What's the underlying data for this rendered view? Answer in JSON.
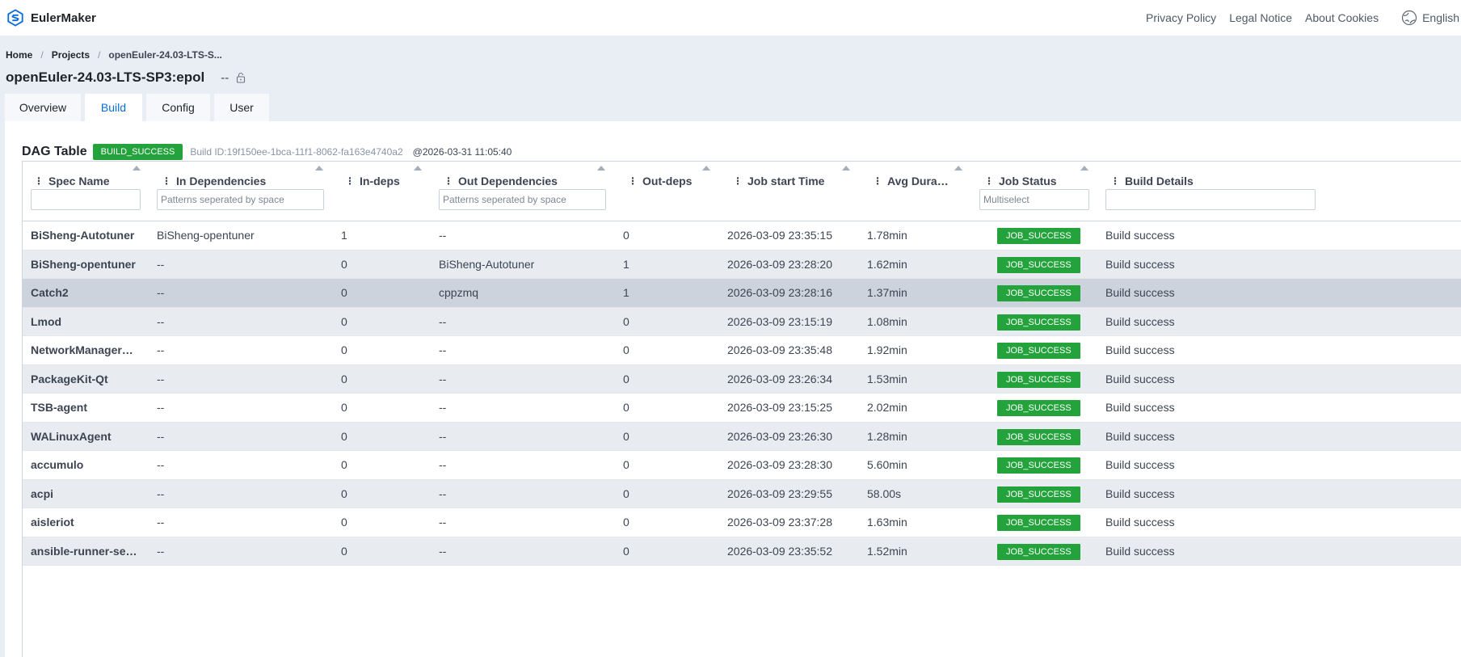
{
  "topbar": {
    "app_name": "EulerMaker",
    "links": [
      "Privacy Policy",
      "Legal Notice",
      "About Cookies"
    ],
    "language": "English"
  },
  "breadcrumb": [
    "Home",
    "Projects",
    "openEuler-24.03-LTS-S..."
  ],
  "page": {
    "title": "openEuler-24.03-LTS-SP3:epol",
    "dash": "--"
  },
  "tabs": [
    "Overview",
    "Build",
    "Config",
    "User"
  ],
  "active_tab": "Build",
  "dag": {
    "title": "DAG Table",
    "status": "BUILD_SUCCESS",
    "build_id": "Build ID:19f150ee-1bca-11f1-8062-fa163e4740a2",
    "time": "@2026-03-31 11:05:40"
  },
  "columns": [
    "Spec Name",
    "In Dependencies",
    "In-deps",
    "Out Dependencies",
    "Out-deps",
    "Job start Time",
    "Avg Dura…",
    "Job Status",
    "Build Details"
  ],
  "filters": {
    "in_deps_placeholder": "Patterns seperated by space",
    "out_deps_placeholder": "Patterns seperated by space",
    "status_placeholder": "Multiselect"
  },
  "rows": [
    {
      "name": "BiSheng-Autotuner",
      "in_deps": "BiSheng-opentuner",
      "in_count": "1",
      "out_deps": "--",
      "out_count": "0",
      "start": "2026-03-09 23:35:15",
      "avg": "1.78min",
      "status": "JOB_SUCCESS",
      "details": "Build success"
    },
    {
      "name": "BiSheng-opentuner",
      "in_deps": "--",
      "in_count": "0",
      "out_deps": "BiSheng-Autotuner",
      "out_count": "1",
      "start": "2026-03-09 23:28:20",
      "avg": "1.62min",
      "status": "JOB_SUCCESS",
      "details": "Build success"
    },
    {
      "name": "Catch2",
      "in_deps": "--",
      "in_count": "0",
      "out_deps": "cppzmq",
      "out_count": "1",
      "start": "2026-03-09 23:28:16",
      "avg": "1.37min",
      "status": "JOB_SUCCESS",
      "details": "Build success"
    },
    {
      "name": "Lmod",
      "in_deps": "--",
      "in_count": "0",
      "out_deps": "--",
      "out_count": "0",
      "start": "2026-03-09 23:15:19",
      "avg": "1.08min",
      "status": "JOB_SUCCESS",
      "details": "Build success"
    },
    {
      "name": "NetworkManager…",
      "in_deps": "--",
      "in_count": "0",
      "out_deps": "--",
      "out_count": "0",
      "start": "2026-03-09 23:35:48",
      "avg": "1.92min",
      "status": "JOB_SUCCESS",
      "details": "Build success"
    },
    {
      "name": "PackageKit-Qt",
      "in_deps": "--",
      "in_count": "0",
      "out_deps": "--",
      "out_count": "0",
      "start": "2026-03-09 23:26:34",
      "avg": "1.53min",
      "status": "JOB_SUCCESS",
      "details": "Build success"
    },
    {
      "name": "TSB-agent",
      "in_deps": "--",
      "in_count": "0",
      "out_deps": "--",
      "out_count": "0",
      "start": "2026-03-09 23:15:25",
      "avg": "2.02min",
      "status": "JOB_SUCCESS",
      "details": "Build success"
    },
    {
      "name": "WALinuxAgent",
      "in_deps": "--",
      "in_count": "0",
      "out_deps": "--",
      "out_count": "0",
      "start": "2026-03-09 23:26:30",
      "avg": "1.28min",
      "status": "JOB_SUCCESS",
      "details": "Build success"
    },
    {
      "name": "accumulo",
      "in_deps": "--",
      "in_count": "0",
      "out_deps": "--",
      "out_count": "0",
      "start": "2026-03-09 23:28:30",
      "avg": "5.60min",
      "status": "JOB_SUCCESS",
      "details": "Build success"
    },
    {
      "name": "acpi",
      "in_deps": "--",
      "in_count": "0",
      "out_deps": "--",
      "out_count": "0",
      "start": "2026-03-09 23:29:55",
      "avg": "58.00s",
      "status": "JOB_SUCCESS",
      "details": "Build success"
    },
    {
      "name": "aisleriot",
      "in_deps": "--",
      "in_count": "0",
      "out_deps": "--",
      "out_count": "0",
      "start": "2026-03-09 23:37:28",
      "avg": "1.63min",
      "status": "JOB_SUCCESS",
      "details": "Build success"
    },
    {
      "name": "ansible-runner-se…",
      "in_deps": "--",
      "in_count": "0",
      "out_deps": "--",
      "out_count": "0",
      "start": "2026-03-09 23:35:52",
      "avg": "1.52min",
      "status": "JOB_SUCCESS",
      "details": "Build success"
    }
  ],
  "colors": {
    "accent": "#0a6dd9",
    "success": "#24a33d",
    "page_bg": "#e9eef5",
    "row_highlight": "#cdd3dc"
  }
}
